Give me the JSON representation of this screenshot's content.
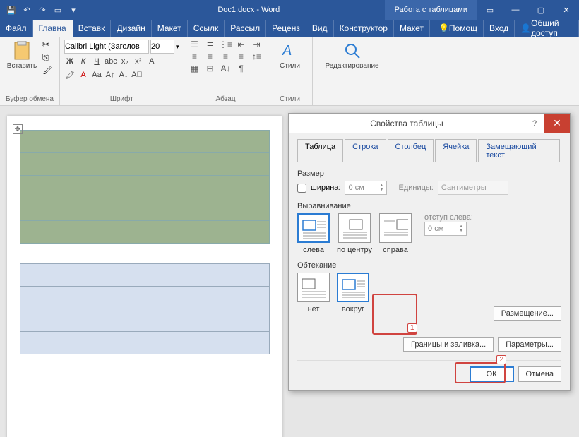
{
  "titlebar": {
    "doc_title": "Doc1.docx - Word",
    "table_tools": "Работа с таблицами"
  },
  "tabs": {
    "file": "Файл",
    "home": "Главна",
    "insert": "Вставк",
    "design": "Дизайн",
    "layout": "Макет",
    "refs": "Ссылк",
    "mail": "Рассыл",
    "review": "Реценз",
    "view": "Вид",
    "constructor": "Конструктор",
    "layout2": "Макет",
    "help": "Помощ",
    "signin": "Вход",
    "share": "Общий доступ"
  },
  "ribbon": {
    "clipboard": {
      "paste": "Вставить",
      "label": "Буфер обмена"
    },
    "font": {
      "name": "Calibri Light (Заголов",
      "size": "20",
      "label": "Шрифт"
    },
    "paragraph": {
      "label": "Абзац"
    },
    "styles": {
      "btn": "Стили",
      "label": "Стили"
    },
    "editing": {
      "btn": "Редактирование"
    }
  },
  "dialog": {
    "title": "Свойства таблицы",
    "tabs": {
      "table": "Таблица",
      "row": "Строка",
      "column": "Столбец",
      "cell": "Ячейка",
      "alt": "Замещающий текст"
    },
    "size": {
      "label": "Размер",
      "width_chk": "ширина:",
      "width_val": "0 см",
      "units_label": "Единицы:",
      "units_val": "Сантиметры"
    },
    "align": {
      "label": "Выравнивание",
      "left": "слева",
      "center": "по центру",
      "right": "справа",
      "indent_label": "отступ слева:",
      "indent_val": "0 см"
    },
    "wrap": {
      "label": "Обтекание",
      "none": "нет",
      "around": "вокруг",
      "placement": "Размещение..."
    },
    "borders": "Границы и заливка...",
    "params": "Параметры...",
    "ok": "ОК",
    "cancel": "Отмена"
  },
  "callouts": {
    "c1": "1",
    "c2": "2"
  }
}
